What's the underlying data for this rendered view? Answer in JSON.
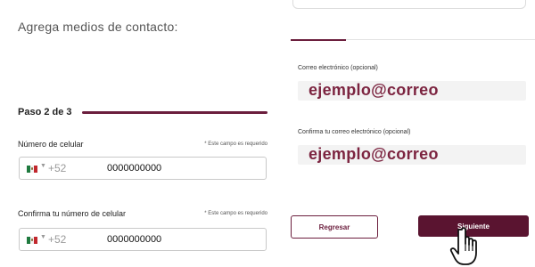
{
  "form": {
    "heading": "Agrega medios de contacto:",
    "step": "Paso 2 de 3",
    "phone": {
      "label": "Número de celular",
      "required_note": "* Este campo es requerido",
      "country_icon": "mexico-flag-icon",
      "prefix": "+52",
      "value": "0000000000"
    },
    "phone_confirm": {
      "label": "Confirma tu número de celular",
      "required_note": "* Este campo es requerido",
      "country_icon": "mexico-flag-icon",
      "prefix": "+52",
      "value": "0000000000"
    },
    "email": {
      "label": "Correo electrónico (opcional)",
      "value": "ejemplo@correo"
    },
    "email_confirm": {
      "label": "Confirma tu correo electrónico (opcional)",
      "value": "ejemplo@correo"
    }
  },
  "actions": {
    "back_label": "Regresar",
    "next_label": "Siguiente"
  },
  "colors": {
    "accent": "#6b1e3d",
    "primary_button": "#5a1430",
    "email_text": "#7c2440"
  },
  "cursor_icon": "hand-pointer-icon"
}
